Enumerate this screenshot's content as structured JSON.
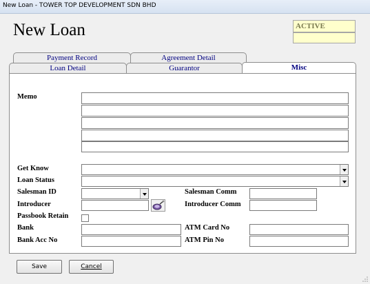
{
  "window": {
    "title": "New Loan - TOWER TOP DEVELOPMENT SDN BHD"
  },
  "header": {
    "title": "New Loan",
    "status": "ACTIVE"
  },
  "tabs": {
    "back": [
      "Payment Record",
      "Agreement Detail"
    ],
    "front": [
      "Loan Detail",
      "Guarantor",
      "Misc"
    ],
    "active": "Misc"
  },
  "form": {
    "memo_label": "Memo",
    "get_know_label": "Get Know",
    "loan_status_label": "Loan Status",
    "salesman_id_label": "Salesman ID",
    "salesman_comm_label": "Salesman Comm",
    "introducer_label": "Introducer",
    "introducer_comm_label": "Introducer Comm",
    "passbook_retain_label": "Passbook Retain",
    "bank_label": "Bank",
    "atm_card_label": "ATM Card No",
    "bank_acc_label": "Bank Acc No",
    "atm_pin_label": "ATM Pin No",
    "passbook_retain_checked": false
  },
  "buttons": {
    "save": "Save",
    "cancel": "Cancel"
  },
  "icons": {
    "lookup": "search-lookup-icon"
  }
}
